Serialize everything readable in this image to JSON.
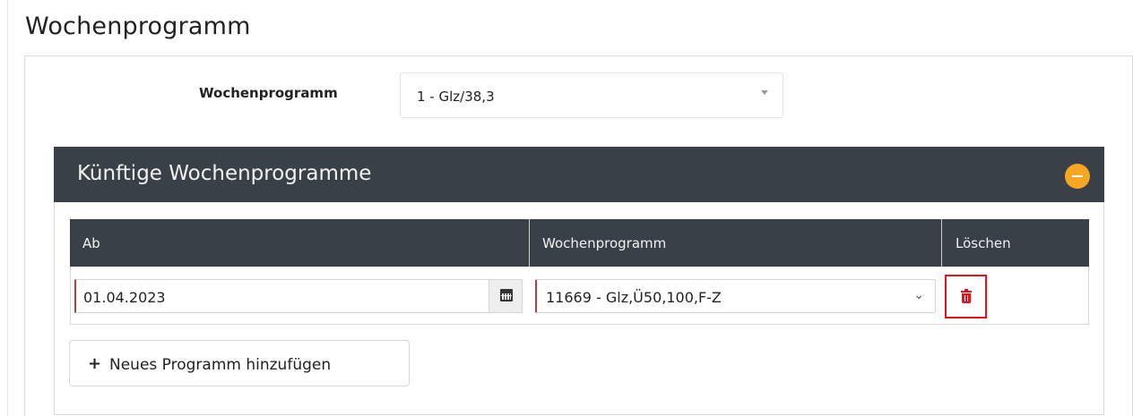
{
  "page": {
    "title": "Wochenprogramm"
  },
  "form": {
    "wochenprogramm_label": "Wochenprogramm",
    "wochenprogramm_value": "1 - Glz/38,3"
  },
  "future_panel": {
    "title": "Künftige Wochenprogramme",
    "columns": [
      "Ab",
      "Wochenprogramm",
      "Löschen"
    ],
    "rows": [
      {
        "ab": "01.04.2023",
        "wochenprogramm": "11669 - Glz,Ü50,100,F-Z"
      }
    ],
    "add_button_label": "Neues Programm hinzufügen"
  },
  "icons": {
    "collapse": "minus-circle-icon",
    "calendar": "calendar-icon",
    "delete": "trash-icon",
    "add": "plus-icon",
    "dropdown": "chevron-down-icon"
  },
  "colors": {
    "header_bg": "#3a4047",
    "collapse_button": "#f5a623",
    "delete_highlight": "#e8101a",
    "required_marker": "#a94442"
  }
}
